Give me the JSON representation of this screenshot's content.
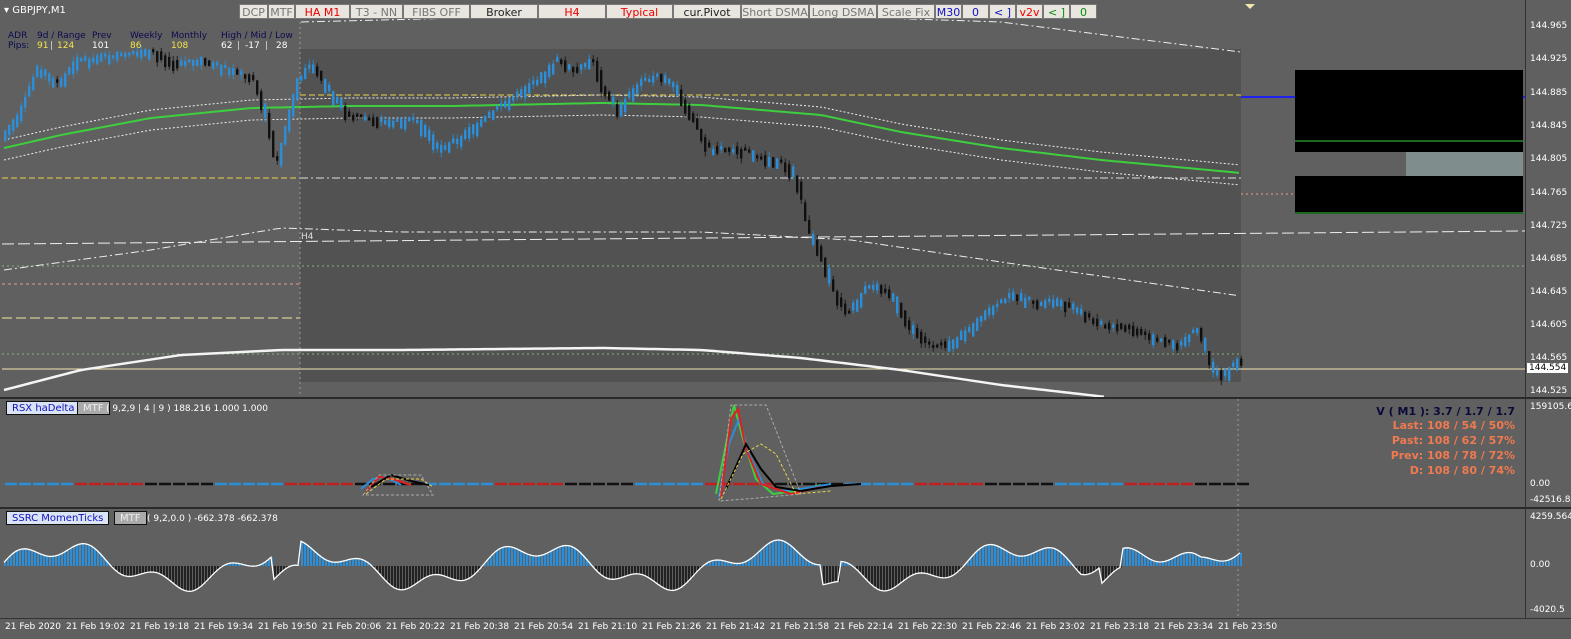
{
  "symbol": "GBPJPY,M1",
  "toolbar": [
    {
      "label": "DCP",
      "style": "gray"
    },
    {
      "label": "MTF",
      "style": "gray"
    },
    {
      "label": "HA M1",
      "style": "red"
    },
    {
      "label": "T3 - NN",
      "style": "gray"
    },
    {
      "label": "FIBS OFF",
      "style": "gray"
    },
    {
      "label": "Broker",
      "style": "dark"
    },
    {
      "label": "H4",
      "style": "red"
    },
    {
      "label": "Typical",
      "style": "red"
    },
    {
      "label": "cur.Pivot",
      "style": "dark"
    },
    {
      "label": "Short DSMA",
      "style": "gray"
    },
    {
      "label": "Long DSMA",
      "style": "gray"
    },
    {
      "label": "Scale Fix",
      "style": "gray"
    },
    {
      "label": "M30",
      "style": "blue"
    },
    {
      "label": "0",
      "style": "blue"
    },
    {
      "label": "< ]",
      "style": "blue"
    },
    {
      "label": "v2v",
      "style": "red"
    },
    {
      "label": "< ]",
      "style": "green"
    },
    {
      "label": "0",
      "style": "green"
    }
  ],
  "adr_panel": {
    "row1": [
      "ADR",
      "9d / Range",
      "Prev",
      "Weekly",
      "Monthly",
      "High / Mid / Low"
    ],
    "row2_label": "Pips:",
    "adr": "91",
    "range": "124",
    "prev": "101",
    "weekly": "86",
    "monthly": "108",
    "high": "62",
    "mid": "-17",
    "low": "28"
  },
  "chart_label_h4": "H4",
  "price_axis": {
    "ticks": [
      "144.965",
      "144.925",
      "144.885",
      "144.845",
      "144.805",
      "144.765",
      "144.725",
      "144.685",
      "144.645",
      "144.605",
      "144.565",
      "144.525"
    ],
    "current": "144.554"
  },
  "indicator1": {
    "name": "RSX haDelta",
    "mtf": "MTF",
    "params": "( 9,2,9 | 4 | 9 ) 188.216 1.000 1.000",
    "scale_top": "159105.6",
    "scale_zero": "0.00",
    "scale_bottom": "-42516.84",
    "stats": [
      {
        "text": "V ( M1 ): 3.7 / 1.7 / 1.7",
        "color": "#0a0a3a"
      },
      {
        "text": "Last: 108 / 54 / 50%",
        "color": "#f07a50"
      },
      {
        "text": "Past: 108 / 62 / 57%",
        "color": "#f07a50"
      },
      {
        "text": "Prev: 108 / 78 / 72%",
        "color": "#f07a50"
      },
      {
        "text": "D: 108 / 80 / 74%",
        "color": "#f07a50"
      }
    ]
  },
  "indicator2": {
    "name": "SSRC MomenTicks",
    "mtf": "MTF",
    "params": "( 9,2,0.0 ) -662.378 -662.378",
    "scale_top": "4259.564",
    "scale_zero": "0.00",
    "scale_bottom": "-4020.5"
  },
  "time_axis": [
    "21 Feb 2020",
    "21 Feb 19:02",
    "21 Feb 19:18",
    "21 Feb 19:34",
    "21 Feb 19:50",
    "21 Feb 20:06",
    "21 Feb 20:22",
    "21 Feb 20:38",
    "21 Feb 20:54",
    "21 Feb 21:10",
    "21 Feb 21:26",
    "21 Feb 21:42",
    "21 Feb 21:58",
    "21 Feb 22:14",
    "21 Feb 22:30",
    "21 Feb 22:46",
    "21 Feb 23:02",
    "21 Feb 23:18",
    "21 Feb 23:34",
    "21 Feb 23:50"
  ],
  "colors": {
    "background": "#606060",
    "bull": "#2a8fd8",
    "bear": "#111111",
    "green_ma": "#3ecf3e",
    "pivot": "#2222ee"
  }
}
